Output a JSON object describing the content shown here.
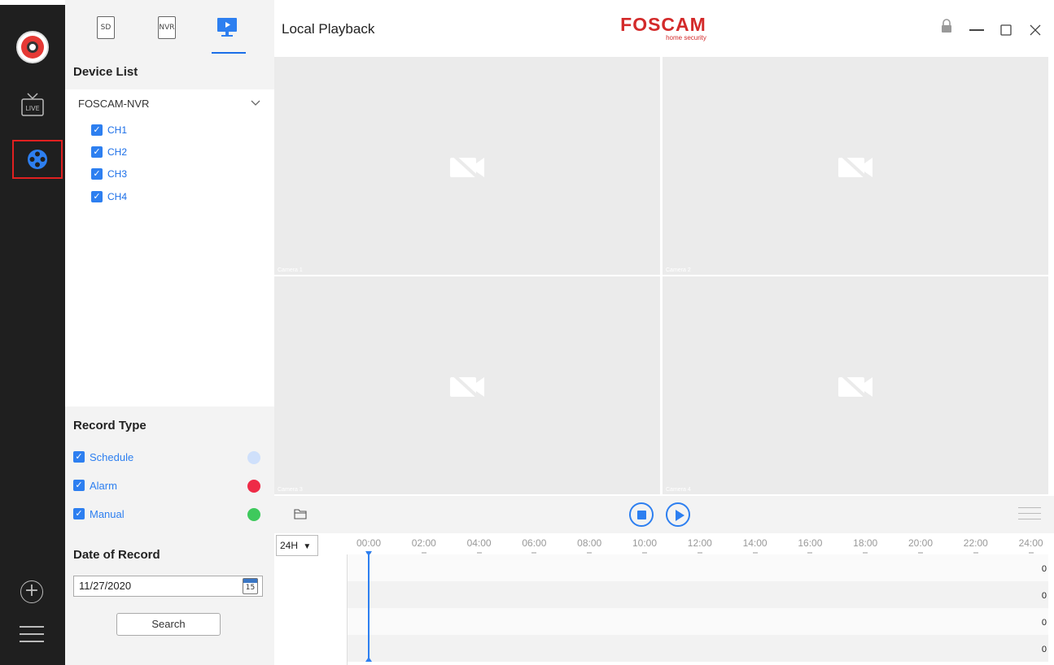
{
  "window": {
    "title": "Local Playback"
  },
  "brand": {
    "name": "FOSCAM",
    "tagline": "home security",
    "color": "#d32a2a"
  },
  "accent_color": "#2d7ff0",
  "rail": {
    "icons": [
      "app-logo-icon",
      "live-tv-icon",
      "playback-film-icon",
      "add-device-icon",
      "menu-icon"
    ],
    "live_label": "LIVE"
  },
  "source_tabs": [
    {
      "label": "SD"
    },
    {
      "label": "NVR"
    },
    {
      "label": "",
      "icon": "monitor-play-icon",
      "active": true
    }
  ],
  "device_list": {
    "title": "Device List",
    "device": "FOSCAM-NVR",
    "channels": [
      {
        "label": "CH1",
        "checked": true
      },
      {
        "label": "CH2",
        "checked": true
      },
      {
        "label": "CH3",
        "checked": true
      },
      {
        "label": "CH4",
        "checked": true
      }
    ]
  },
  "record_type": {
    "title": "Record Type",
    "items": [
      {
        "label": "Schedule",
        "checked": true,
        "color": "#cfe0fb"
      },
      {
        "label": "Alarm",
        "checked": true,
        "color": "#ee2b47"
      },
      {
        "label": "Manual",
        "checked": true,
        "color": "#3ec95c"
      }
    ]
  },
  "date_of_record": {
    "title": "Date of Record",
    "value": "11/27/2020",
    "calendar_day": "15",
    "search_label": "Search"
  },
  "video_cells": [
    {
      "label": "Camera 1"
    },
    {
      "label": "Camera 2"
    },
    {
      "label": "Camera 3"
    },
    {
      "label": "Camera 4"
    }
  ],
  "timeline": {
    "scale": "24H",
    "ticks": [
      "00:00",
      "02:00",
      "04:00",
      "06:00",
      "08:00",
      "10:00",
      "12:00",
      "14:00",
      "16:00",
      "18:00",
      "20:00",
      "22:00",
      "24:00"
    ],
    "track_values": [
      "0",
      "0",
      "0",
      "0"
    ]
  }
}
